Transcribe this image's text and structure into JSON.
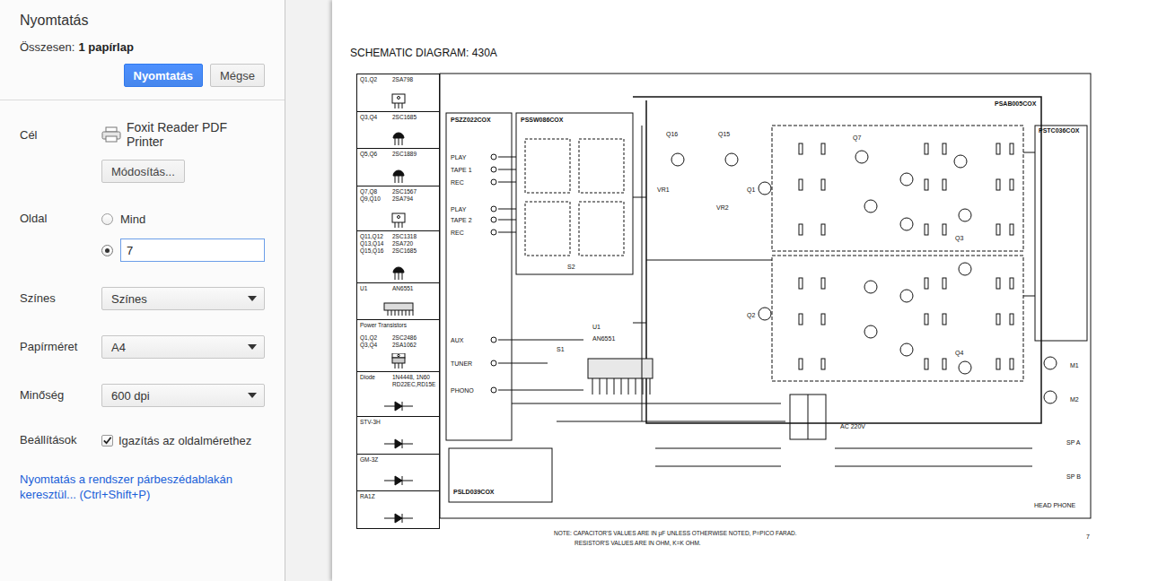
{
  "dialog": {
    "title": "Nyomtatás",
    "summary_label": "Összesen:",
    "summary_value": "1 papírlap",
    "buttons": [
      {
        "label": "Nyomtatás",
        "primary": true
      },
      {
        "label": "Mégse",
        "primary": false
      }
    ]
  },
  "destination": {
    "label": "Cél",
    "printer": "Foxit Reader PDF Printer",
    "change_button": "Módosítás..."
  },
  "pages": {
    "label": "Oldal",
    "options": [
      {
        "kind": "all",
        "label": "Mind",
        "selected": false
      },
      {
        "kind": "custom",
        "value": "7",
        "selected": true
      }
    ]
  },
  "selects": [
    {
      "label": "Színes",
      "value": "Színes"
    },
    {
      "label": "Papírméret",
      "value": "A4"
    },
    {
      "label": "Minőség",
      "value": "600 dpi"
    }
  ],
  "options": {
    "label": "Beállítások",
    "checkbox": {
      "label": "Igazítás az oldalmérethez",
      "checked": true
    }
  },
  "system_dialog_link": "Nyomtatás a rendszer párbeszédablakán keresztül... (Ctrl+Shift+P)",
  "preview": {
    "title": "SCHEMATIC DIAGRAM: 430A",
    "legend": [
      {
        "names": [
          "Q1,Q2"
        ],
        "parts": [
          "2SA798"
        ],
        "kind": "to126"
      },
      {
        "names": [
          "Q3,Q4"
        ],
        "parts": [
          "2SC1685"
        ],
        "kind": "to92"
      },
      {
        "names": [
          "Q5,Q6"
        ],
        "parts": [
          "2SC1889"
        ],
        "kind": "to92"
      },
      {
        "names": [
          "Q7,Q8",
          "Q9,Q10"
        ],
        "parts": [
          "2SC1567",
          "2SA794"
        ],
        "kind": "to126"
      },
      {
        "names": [
          "Q11,Q12",
          "Q13,Q14",
          "Q15,Q16"
        ],
        "parts": [
          "2SC1318",
          "2SA720",
          "2SC1685"
        ],
        "kind": "to92"
      },
      {
        "names": [
          "U1"
        ],
        "parts": [
          "AN6551"
        ],
        "kind": "ic"
      },
      {
        "heading": "Power Transistors",
        "names": [
          "Q1,Q2",
          "Q3,Q4"
        ],
        "parts": [
          "2SC2486",
          "2SA1062"
        ],
        "kind": "to220"
      },
      {
        "names": [
          "Diode"
        ],
        "parts": [
          "1N4448, 1N60",
          "RD22EC,RD15E"
        ],
        "kind": "diode"
      },
      {
        "names": [
          "STV-3H"
        ],
        "parts": [],
        "kind": "diode"
      },
      {
        "names": [
          "GM-3Z"
        ],
        "parts": [],
        "kind": "diode"
      },
      {
        "names": [
          "RA1Z"
        ],
        "parts": [],
        "kind": "diode"
      }
    ],
    "boards": [
      "PSZZ022COX",
      "PSSW086COX",
      "PSAB005COX",
      "PSTC036COX",
      "PSLD039COX"
    ],
    "labels": [
      "PLAY",
      "TAPE 1",
      "REC",
      "PLAY",
      "TAPE 2",
      "REC",
      "AUX",
      "TUNER",
      "PHONO",
      "U1",
      "AN6551",
      "S1",
      "S2",
      "Q16",
      "Q15",
      "VR1",
      "VR2",
      "Q1",
      "Q2",
      "Q7",
      "Q3",
      "Q4",
      "M1",
      "M2",
      "AC 220V",
      "SP A",
      "SP B",
      "HEAD PHONE"
    ],
    "note": [
      "NOTE:  CAPACITOR'S VALUES ARE IN μF UNLESS OTHERWISE NOTED, P=PICO FARAD.",
      "RESISTOR'S VALUES ARE IN OHM, K=K OHM."
    ],
    "page_number": "7"
  }
}
